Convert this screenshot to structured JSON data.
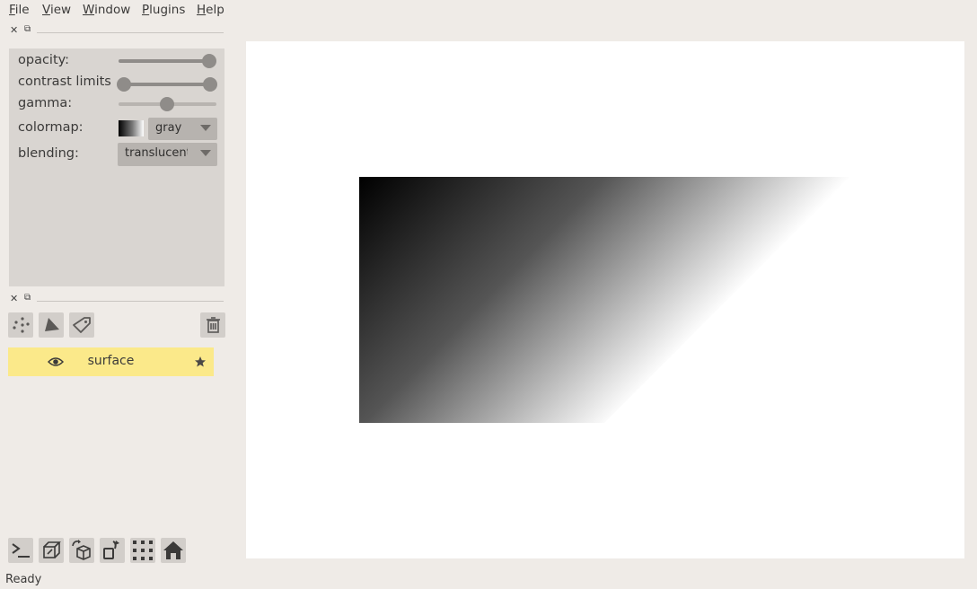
{
  "menu": {
    "file": {
      "mnemonic": "F",
      "rest": "ile"
    },
    "view": {
      "mnemonic": "V",
      "rest": "iew"
    },
    "window": {
      "mnemonic": "W",
      "rest": "indow"
    },
    "plugins": {
      "mnemonic": "P",
      "rest": "lugins"
    },
    "help": {
      "mnemonic": "H",
      "rest": "elp"
    }
  },
  "dock": {
    "close_glyph": "✕",
    "float_glyph": "⧉"
  },
  "layer_controls": {
    "opacity_label": "opacity:",
    "opacity_value": 1.0,
    "contrast_label": "contrast limits",
    "contrast_range": [
      0.0,
      1.0
    ],
    "gamma_label": "gamma:",
    "gamma_value": 0.5,
    "colormap_label": "colormap:",
    "colormap_value": "gray",
    "blending_label": "blending:",
    "blending_value": "translucent"
  },
  "layer_buttons": {
    "points_icon": "points-icon",
    "shapes_icon": "shapes-icon",
    "labels_icon": "labels-icon",
    "delete_icon": "trash-icon"
  },
  "layers": [
    {
      "name": "surface",
      "visible": true,
      "selected": true
    }
  ],
  "viewer_buttons": [
    "console-icon",
    "ndisplay-icon",
    "roll-dims-icon",
    "transpose-icon",
    "grid-icon",
    "home-icon"
  ],
  "colors": {
    "selected_layer": "#fbe98a",
    "panel": "#d9d5d1",
    "background": "#efebe7"
  },
  "status": {
    "text": "Ready"
  }
}
